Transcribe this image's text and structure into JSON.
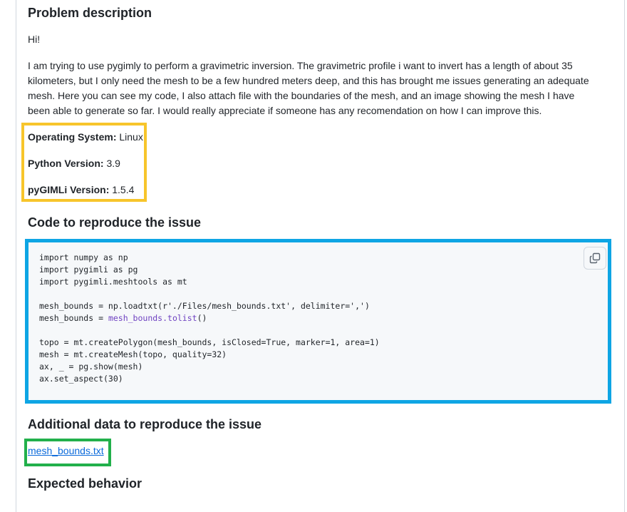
{
  "sections": {
    "problem_description": "Problem description",
    "code_heading": "Code to reproduce the issue",
    "additional_heading": "Additional data to reproduce the issue",
    "expected_heading": "Expected behavior"
  },
  "greeting": "Hi!",
  "body": "I am trying to use pygimly to perform a gravimetric inversion. The gravimetric profile i want to invert has a length of about 35 kilometers, but I only need the mesh to be a few hundred meters deep, and this has brought me issues generating an adequate mesh. Here you can see my code, I also attach file with the boundaries of the mesh, and an image showing the mesh I have been able to generate so far. I would really appreciate if someone has any recomendation on how I can improve this.",
  "env": {
    "os_label": "Operating System:",
    "os_value": " Linux",
    "python_label": "Python Version:",
    "python_value": " 3.9",
    "pygimli_label": "pyGIMLi Version:",
    "pygimli_value": " 1.5.4"
  },
  "code": {
    "l1": "import numpy as np",
    "l2": "import pygimli as pg",
    "l3": "import pygimli.meshtools as mt",
    "l4": "mesh_bounds = np.loadtxt(r'./Files/mesh_bounds.txt', delimiter=',')",
    "l5a": "mesh_bounds = ",
    "l5b": "mesh_bounds.tolist",
    "l5c": "()",
    "l6": "topo = mt.createPolygon(mesh_bounds, isClosed=True, marker=1, area=1)",
    "l7": "mesh = mt.createMesh(topo, quality=32)",
    "l8": "ax, _ = pg.show(mesh)",
    "l9": "ax.set_aspect(30)"
  },
  "attachment": "mesh_bounds.txt",
  "highlight_colors": {
    "yellow": "#f7c52b",
    "blue": "#0ea5e4",
    "green": "#22b04b"
  },
  "icons": {
    "copy": "copy-icon"
  }
}
